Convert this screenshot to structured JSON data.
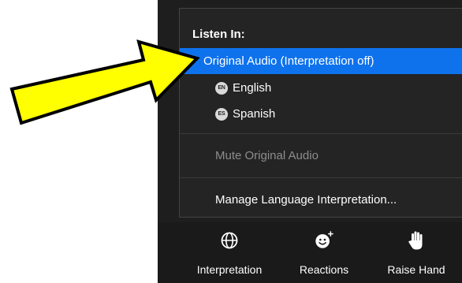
{
  "menu": {
    "header": "Listen In:",
    "items": [
      {
        "label": "Original Audio (Interpretation off)",
        "selected": true,
        "check": "✓"
      },
      {
        "label": "English",
        "badge": "EN"
      },
      {
        "label": "Spanish",
        "badge": "ES"
      }
    ],
    "mute_label": "Mute Original Audio",
    "manage_label": "Manage Language Interpretation..."
  },
  "toolbar": {
    "interpretation_label": "Interpretation",
    "reactions_label": "Reactions",
    "raise_hand_label": "Raise Hand"
  },
  "icons": {
    "interpretation": "globe-icon",
    "reactions": "smiley-plus-icon",
    "raise_hand": "hand-icon",
    "annotation": "yellow-arrow"
  },
  "colors": {
    "selected_bg": "#0e72ed",
    "menu_bg": "#242424",
    "toolbar_bg": "#1a1a1a",
    "disabled_text": "#8d8d8d",
    "arrow_fill": "#ffff00"
  }
}
